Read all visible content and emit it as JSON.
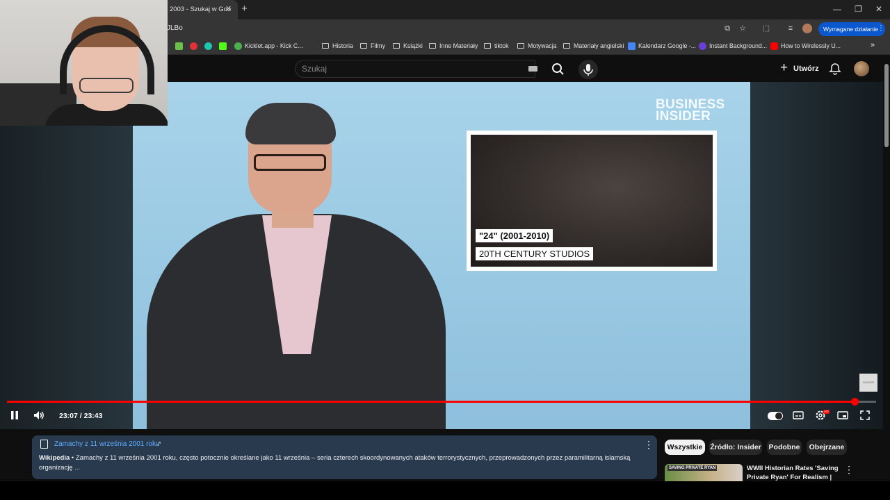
{
  "browser": {
    "tab_title": "2003 - Szukaj w Goo",
    "tab_close": "✕",
    "new_tab": "+",
    "url_fragment": "JLBo",
    "action_required_label": "Wymagane działanie",
    "bookmarks": [
      {
        "label": "Kicklet.app - Kick C...",
        "icon": "kicklet-icon",
        "color": "#4caf50"
      },
      {
        "label": "Historia",
        "icon": "folder-icon"
      },
      {
        "label": "Filmy",
        "icon": "folder-icon"
      },
      {
        "label": "Książki",
        "icon": "folder-icon"
      },
      {
        "label": "Inne Materiały",
        "icon": "folder-icon"
      },
      {
        "label": "tiktok",
        "icon": "folder-icon"
      },
      {
        "label": "Motywacja",
        "icon": "folder-icon"
      },
      {
        "label": "Materiały angielski",
        "icon": "folder-icon"
      },
      {
        "label": "Kalendarz Google -...",
        "icon": "calendar-icon",
        "color": "#4285f4"
      },
      {
        "label": "Instant Background...",
        "icon": "photoroom-icon",
        "color": "#6a3fd8"
      },
      {
        "label": "How to Wirelessly U...",
        "icon": "youtube-icon",
        "color": "#ff0000"
      }
    ],
    "bookmarks_overflow": "»"
  },
  "youtube_header": {
    "search_placeholder": "Szukaj",
    "create_label": "Utwórz"
  },
  "video": {
    "watermark": "BUSINESS INSIDER",
    "clip_title": "\"24\" (2001-2010)",
    "clip_studio": "20TH CENTURY STUDIOS",
    "corner_badge": "INSIDER",
    "time_display": "23:07 / 23:43",
    "current_time": "23:07",
    "duration": "23:43",
    "progress_fraction": 0.975,
    "hd_badge": "HD",
    "accent_color": "#ff0000"
  },
  "info_card": {
    "title": "Zamachy z 11 września 2001 roku",
    "external_icon": "↗",
    "source": "Wikipedia",
    "text": " • Zamachy z 11 września 2001 roku, często potocznie określane jako 11 września – seria czterech skoordynowanych ataków terrorystycznych, przeprowadzonych przez paramilitarną islamską organizację ..."
  },
  "chips": [
    "Wszystkie",
    "Źródło: Insider",
    "Podobne",
    "Obejrzane"
  ],
  "recommendation": {
    "thumb_text": "SAVING PRIVATE RYAN",
    "title": "WWII Historian Rates 'Saving Private Ryan' For Realism | Ho..."
  }
}
